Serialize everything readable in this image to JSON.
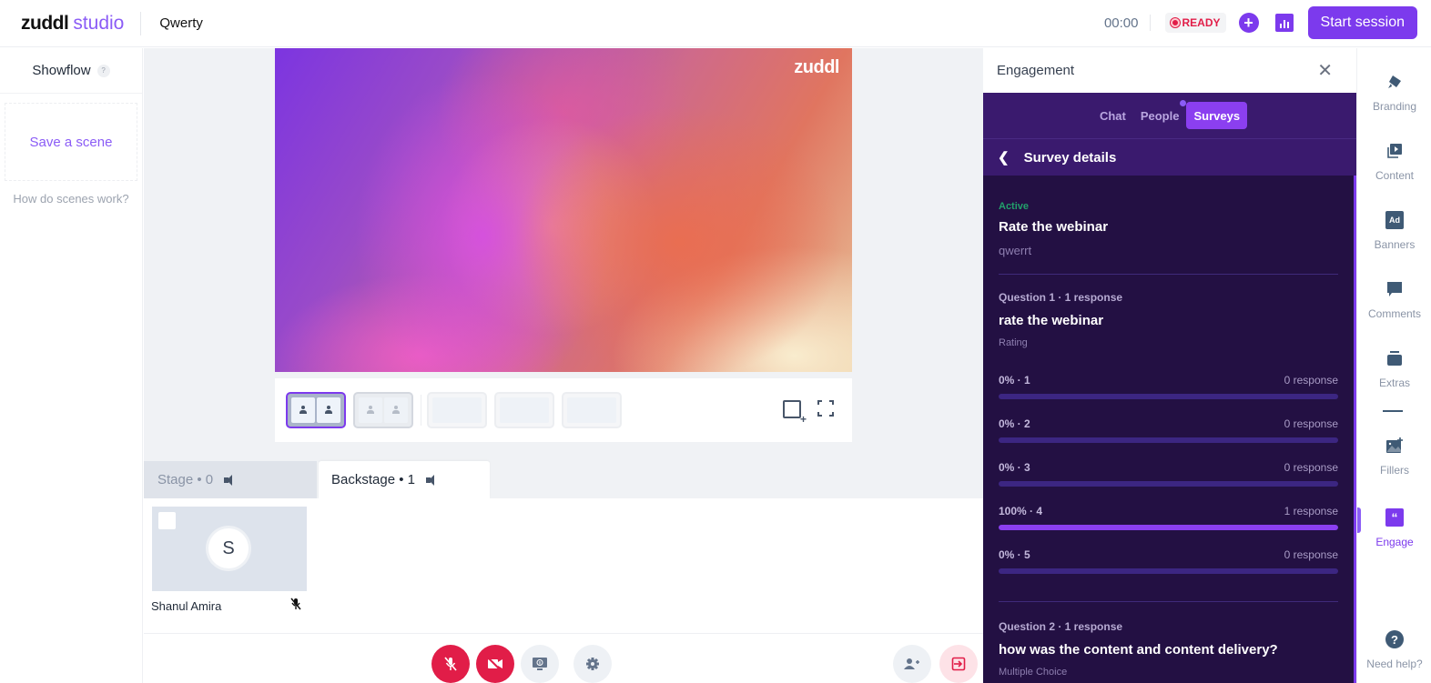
{
  "app": {
    "brand": "zuddl",
    "product": "studio",
    "session_name": "Qwerty"
  },
  "topbar": {
    "timer": "00:00",
    "status": "READY",
    "add_icon": "plus-icon",
    "stats_icon": "bar-chart-icon",
    "start_label": "Start session",
    "accent_color": "#7c3aed",
    "status_color": "#e11d48"
  },
  "showflow": {
    "title": "Showflow",
    "help_badge": "?",
    "save_scene": "Save a scene",
    "how_link": "How do scenes work?"
  },
  "stage": {
    "preview_logo": "zuddl",
    "layouts": [
      {
        "name": "two-up-side",
        "selected": true
      },
      {
        "name": "two-up-split",
        "selected": false
      },
      {
        "name": "screen-with-pip",
        "selected": false
      },
      {
        "name": "screen-with-row",
        "selected": false
      },
      {
        "name": "screen-with-column",
        "selected": false
      }
    ],
    "tabs": [
      {
        "label": "Stage • 0",
        "active": false
      },
      {
        "label": "Backstage • 1",
        "active": true
      }
    ],
    "participants": [
      {
        "initial": "S",
        "name": "Shanul Amira",
        "muted": true
      }
    ]
  },
  "controls": {
    "mic": "mic-off-icon",
    "camera": "camera-off-icon",
    "share": "screen-share-icon",
    "settings": "gear-icon",
    "invite": "add-user-icon",
    "leave": "exit-icon"
  },
  "engagement": {
    "title": "Engagement",
    "tabs": [
      {
        "label": "Chat",
        "active": false
      },
      {
        "label": "People",
        "active": false,
        "notification": true
      },
      {
        "label": "Surveys",
        "active": true
      }
    ],
    "detail_title": "Survey details",
    "survey": {
      "status": "Active",
      "title": "Rate the webinar",
      "description": "qwerrt",
      "questions": [
        {
          "meta": "Question 1 · 1 response",
          "text": "rate the webinar",
          "type": "Rating",
          "options": [
            {
              "label": "0% · 1",
              "responses": "0 response",
              "percent": 0
            },
            {
              "label": "0% · 2",
              "responses": "0 response",
              "percent": 0
            },
            {
              "label": "0% · 3",
              "responses": "0 response",
              "percent": 0
            },
            {
              "label": "100% · 4",
              "responses": "1 response",
              "percent": 100
            },
            {
              "label": "0% · 5",
              "responses": "0 response",
              "percent": 0
            }
          ]
        },
        {
          "meta": "Question 2 · 1 response",
          "text": "how was the content and content delivery?",
          "type": "Multiple Choice"
        }
      ]
    }
  },
  "rail": {
    "items": [
      {
        "label": "Branding",
        "icon": "paint-brush-icon"
      },
      {
        "label": "Content",
        "icon": "play-media-icon"
      },
      {
        "label": "Banners",
        "icon": "ad-banner-icon",
        "glyph": "Ad"
      },
      {
        "label": "Comments",
        "icon": "comment-icon"
      },
      {
        "label": "Extras",
        "icon": "stack-icon"
      },
      {
        "label": "Fillers",
        "icon": "image-add-icon"
      },
      {
        "label": "Engage",
        "icon": "quote-bubble-icon",
        "glyph": "“",
        "active": true
      }
    ],
    "help": "Need help?",
    "help_glyph": "?"
  }
}
